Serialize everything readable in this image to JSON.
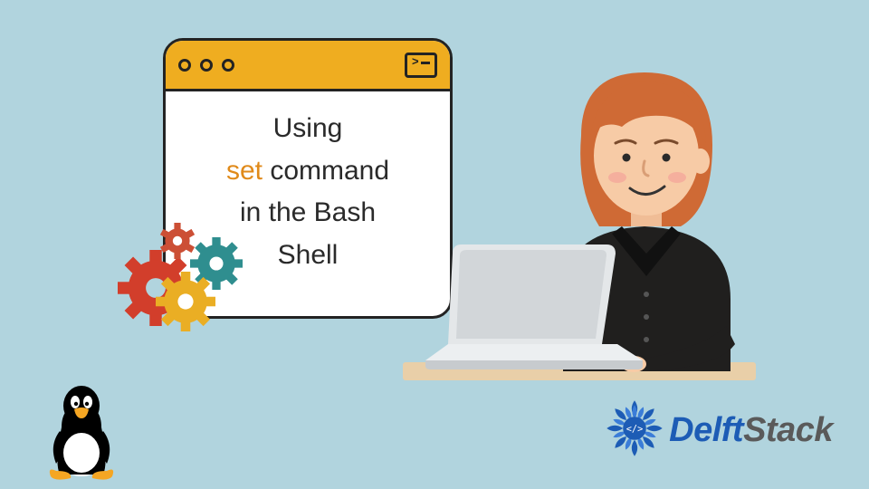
{
  "window": {
    "line1": "Using",
    "highlight": "set",
    "line2_rest": " command",
    "line3": "in the Bash",
    "line4": "Shell"
  },
  "brand": {
    "name_part1": "Delft",
    "name_part2": "Stack"
  },
  "icons": {
    "terminal": "terminal-icon",
    "tux": "tux-linux-icon",
    "gear_red": "gear-icon",
    "gear_teal": "gear-icon",
    "gear_yellow": "gear-icon",
    "gear_small_red": "gear-icon",
    "delft_mark": "delftstack-logo-icon"
  },
  "colors": {
    "bg": "#b1d4de",
    "accent": "#efad20",
    "highlight": "#e08a1a",
    "gear_red": "#d23e2b",
    "gear_teal": "#2f8e8f",
    "gear_yellow": "#eaae24",
    "desk": "#e9cfa8",
    "shirt": "#201f1e",
    "hair": "#cf6a35",
    "skin": "#f7cba6",
    "laptop": "#d7dbde",
    "brand_blue": "#1d5cb5"
  }
}
